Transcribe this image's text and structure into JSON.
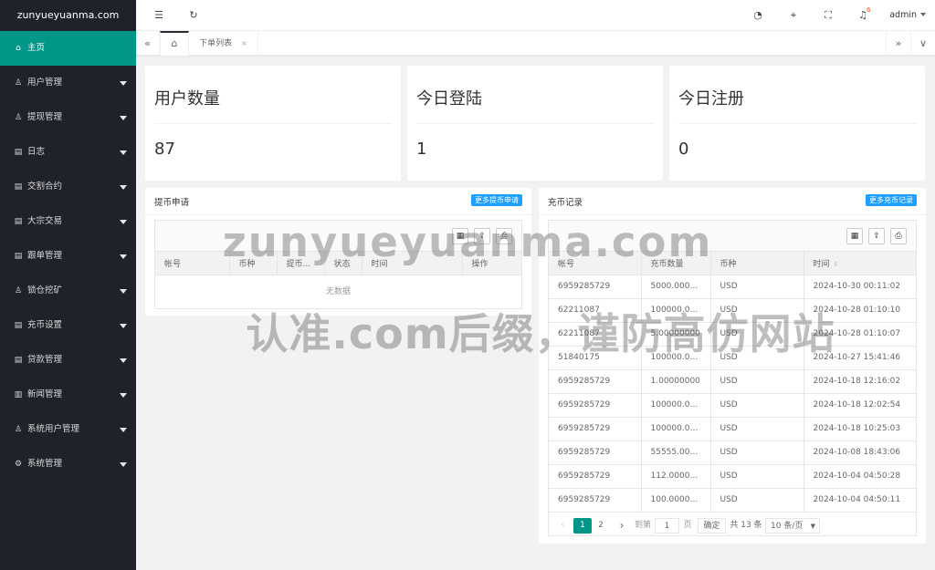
{
  "site": {
    "logo": "zunyueyuanma.com"
  },
  "sidebar": {
    "items": [
      {
        "label": "主页",
        "icon": "home-icon",
        "glyph": "⌂",
        "active": true
      },
      {
        "label": "用户管理",
        "icon": "user-icon",
        "glyph": "♙"
      },
      {
        "label": "提现管理",
        "icon": "user-icon",
        "glyph": "♙"
      },
      {
        "label": "日志",
        "icon": "file-icon",
        "glyph": "▤"
      },
      {
        "label": "交割合约",
        "icon": "file-icon",
        "glyph": "▤"
      },
      {
        "label": "大宗交易",
        "icon": "file-icon",
        "glyph": "▤"
      },
      {
        "label": "跟单管理",
        "icon": "file-icon",
        "glyph": "▤"
      },
      {
        "label": "锁仓挖矿",
        "icon": "user-icon",
        "glyph": "♙"
      },
      {
        "label": "充币设置",
        "icon": "file-icon",
        "glyph": "▤"
      },
      {
        "label": "贷款管理",
        "icon": "file-icon",
        "glyph": "▤"
      },
      {
        "label": "新闻管理",
        "icon": "read-icon",
        "glyph": "▥"
      },
      {
        "label": "系统用户管理",
        "icon": "user-icon",
        "glyph": "♙"
      },
      {
        "label": "系统管理",
        "icon": "gear-icon",
        "glyph": "⚙"
      }
    ]
  },
  "header": {
    "menu_glyph": "☰",
    "refresh_glyph": "↻",
    "theme_glyph": "◔",
    "tag_glyph": "⌖",
    "fullscreen_glyph": "⛶",
    "bell_glyph": "♫",
    "notification_count": "6",
    "user": "admin"
  },
  "tabs": {
    "prev_glyph": "«",
    "next_glyph": "»",
    "dropdown_glyph": "∨",
    "home_glyph": "⌂",
    "open": [
      {
        "label": "下单列表",
        "close": "×"
      }
    ]
  },
  "stats": [
    {
      "title": "用户数量",
      "value": "87"
    },
    {
      "title": "今日登陆",
      "value": "1"
    },
    {
      "title": "今日注册",
      "value": "0"
    }
  ],
  "withdraw": {
    "title": "提币申请",
    "more": "更多提币申请",
    "columns": [
      "帐号",
      "币种",
      "提币...",
      "状态",
      "时间",
      "操作"
    ],
    "empty": "无数据"
  },
  "recharge": {
    "title": "充币记录",
    "more": "更多充币记录",
    "columns": [
      "帐号",
      "充币数量",
      "币种",
      "时间"
    ],
    "sort_glyph": "⇕",
    "rows": [
      [
        "6959285729",
        "5000.0000...",
        "USD",
        "2024-10-30 00:11:02"
      ],
      [
        "62211087",
        "100000.00...",
        "USD",
        "2024-10-28 01:10:10"
      ],
      [
        "62211087",
        "5.00000000",
        "USD",
        "2024-10-28 01:10:07"
      ],
      [
        "51840175",
        "100000.00...",
        "USD",
        "2024-10-27 15:41:46"
      ],
      [
        "6959285729",
        "1.00000000",
        "USD",
        "2024-10-18 12:16:02"
      ],
      [
        "6959285729",
        "100000.00...",
        "USD",
        "2024-10-18 12:02:54"
      ],
      [
        "6959285729",
        "100000.00...",
        "USD",
        "2024-10-18 10:25:03"
      ],
      [
        "6959285729",
        "55555.000...",
        "USD",
        "2024-10-08 18:43:06"
      ],
      [
        "6959285729",
        "112.00000...",
        "USD",
        "2024-10-04 04:50:28"
      ],
      [
        "6959285729",
        "100.00000...",
        "USD",
        "2024-10-04 04:50:11"
      ]
    ]
  },
  "pager": {
    "prev": "‹",
    "pages": [
      "1",
      "2"
    ],
    "next": "›",
    "goto_label": "到第",
    "goto_value": "1",
    "page_unit": "页",
    "confirm": "确定",
    "total": "共 13 条",
    "per_page": "10 条/页"
  },
  "toolbar": {
    "columns_glyph": "▦",
    "export_glyph": "⇪",
    "print_glyph": "⎙"
  },
  "watermark": {
    "line1": "zunyueyuanma.com",
    "line2": "认准.com后缀，谨防高仿网站"
  },
  "colors": {
    "sidebar_bg": "#20222a",
    "active": "#009688",
    "link_button": "#1e9fff",
    "badge": "#ff5722"
  }
}
